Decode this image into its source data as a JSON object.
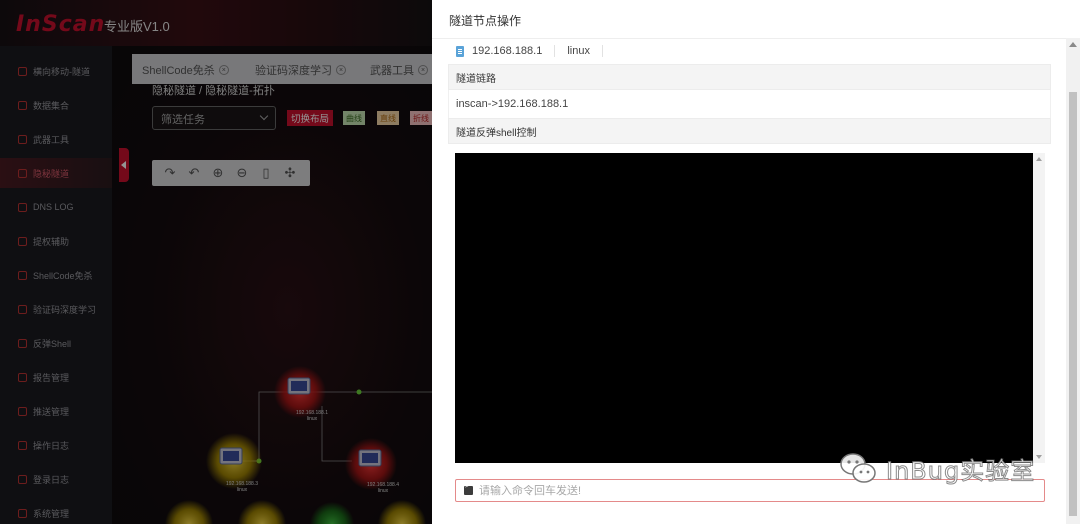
{
  "app": {
    "logo": "InScan",
    "edition": "专业版V1.0"
  },
  "sidebar": {
    "items": [
      {
        "label": "横向移动-隧道",
        "icon": "network-icon",
        "active": false
      },
      {
        "label": "数据集合",
        "icon": "document-icon",
        "active": false
      },
      {
        "label": "武器工具",
        "icon": "wrench-icon",
        "active": false
      },
      {
        "label": "隐秘隧道",
        "icon": "topology-icon",
        "active": true
      },
      {
        "label": "DNS LOG",
        "icon": "globe-icon",
        "active": false
      },
      {
        "label": "提权辅助",
        "icon": "lock-icon",
        "active": false
      },
      {
        "label": "ShellCode免杀",
        "icon": "code-icon",
        "active": false
      },
      {
        "label": "验证码深度学习",
        "icon": "shield-icon",
        "active": false
      },
      {
        "label": "反弹Shell",
        "icon": "target-icon",
        "active": false
      },
      {
        "label": "报告管理",
        "icon": "report-icon",
        "active": false
      },
      {
        "label": "推送管理",
        "icon": "push-icon",
        "active": false
      },
      {
        "label": "操作日志",
        "icon": "log-icon",
        "active": false
      },
      {
        "label": "登录日志",
        "icon": "login-log-icon",
        "active": false
      },
      {
        "label": "系统管理",
        "icon": "gear-icon",
        "active": false
      }
    ]
  },
  "tabs": [
    {
      "label": "ShellCode免杀"
    },
    {
      "label": "验证码深度学习"
    },
    {
      "label": "武器工具"
    }
  ],
  "main": {
    "breadcrumb": "隐秘隧道 / 隐秘隧道-拓扑",
    "filter_placeholder": "筛选任务",
    "layout_button": "切换布局",
    "line_buttons": [
      "曲线",
      "直线",
      "折线"
    ]
  },
  "topology": {
    "nodes": [
      {
        "ip": "192.168.188.1",
        "os": "linux",
        "color": "red"
      },
      {
        "ip": "192.168.188.3",
        "os": "linux",
        "color": "yellow"
      },
      {
        "ip": "192.168.188.4",
        "os": "linux",
        "color": "red"
      }
    ]
  },
  "drawer": {
    "title": "隧道节点操作",
    "node_ip": "192.168.188.1",
    "node_os": "linux",
    "link_header": "隧道链路",
    "link_value": "inscan->192.168.188.1",
    "shell_header": "隧道反弹shell控制",
    "command_placeholder": "请输入命令回车发送!"
  },
  "watermark": {
    "text": "InBug实验室"
  },
  "colors": {
    "brand_red": "#c8102e",
    "terminal_bg": "#000000",
    "input_border": "#e48a8a"
  }
}
